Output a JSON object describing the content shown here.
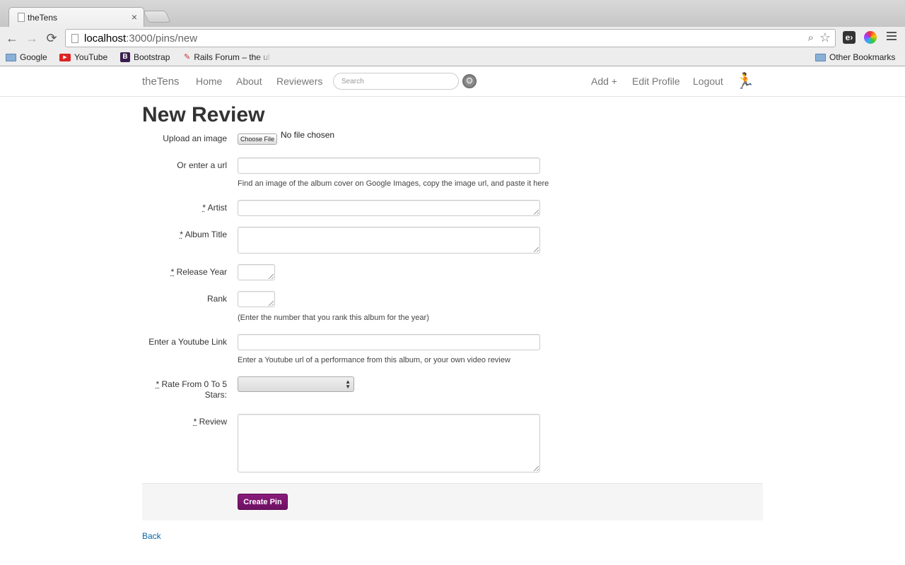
{
  "browser": {
    "tab_title": "theTens",
    "tab_close": "×",
    "url_host": "localhost",
    "url_path": ":3000/pins/new",
    "back_glyph": "←",
    "forward_glyph": "→",
    "reload_glyph": "⟳",
    "zoom_glyph": "⌕",
    "star_glyph": "☆",
    "ext_e_label": "e›",
    "bookmarks": [
      {
        "label": "Google",
        "icon": "folder-icon"
      },
      {
        "label": "YouTube",
        "icon": "youtube-icon"
      },
      {
        "label": "Bootstrap",
        "icon": "bootstrap-icon"
      },
      {
        "label": "Rails Forum – the ult",
        "icon": "rails-icon"
      }
    ],
    "other_bookmarks": "Other Bookmarks",
    "yt_icon_glyph": "▶",
    "bs_icon_glyph": "B",
    "rails_icon_glyph": "✎"
  },
  "navbar": {
    "brand": "theTens",
    "links": [
      "Home",
      "About",
      "Reviewers"
    ],
    "search_placeholder": "Search",
    "right_links": [
      "Add +",
      "Edit Profile",
      "Logout"
    ],
    "avatar_glyph": "🏃"
  },
  "form": {
    "title": "New Review",
    "upload_label": "Upload an image",
    "choose_file": "Choose File",
    "no_file": "No file chosen",
    "url_label": "Or enter a url",
    "url_help": "Find an image of the album cover on Google Images, copy the image url, and paste it here",
    "required_mark": "*",
    "artist_label": "Artist",
    "album_label": "Album Title",
    "year_label": "Release Year",
    "rank_label": "Rank",
    "rank_help": "(Enter the number that you rank this album for the year)",
    "youtube_label": "Enter a Youtube Link",
    "youtube_help": "Enter a Youtube url of a performance from this album, or your own video review",
    "rate_label_line1": "Rate From 0 To 5",
    "rate_label_line2": "Stars:",
    "rate_value": "",
    "review_label": "Review",
    "submit": "Create Pin",
    "back": "Back"
  },
  "colors": {
    "accent": "#7b1570",
    "link": "#0a66a8"
  }
}
